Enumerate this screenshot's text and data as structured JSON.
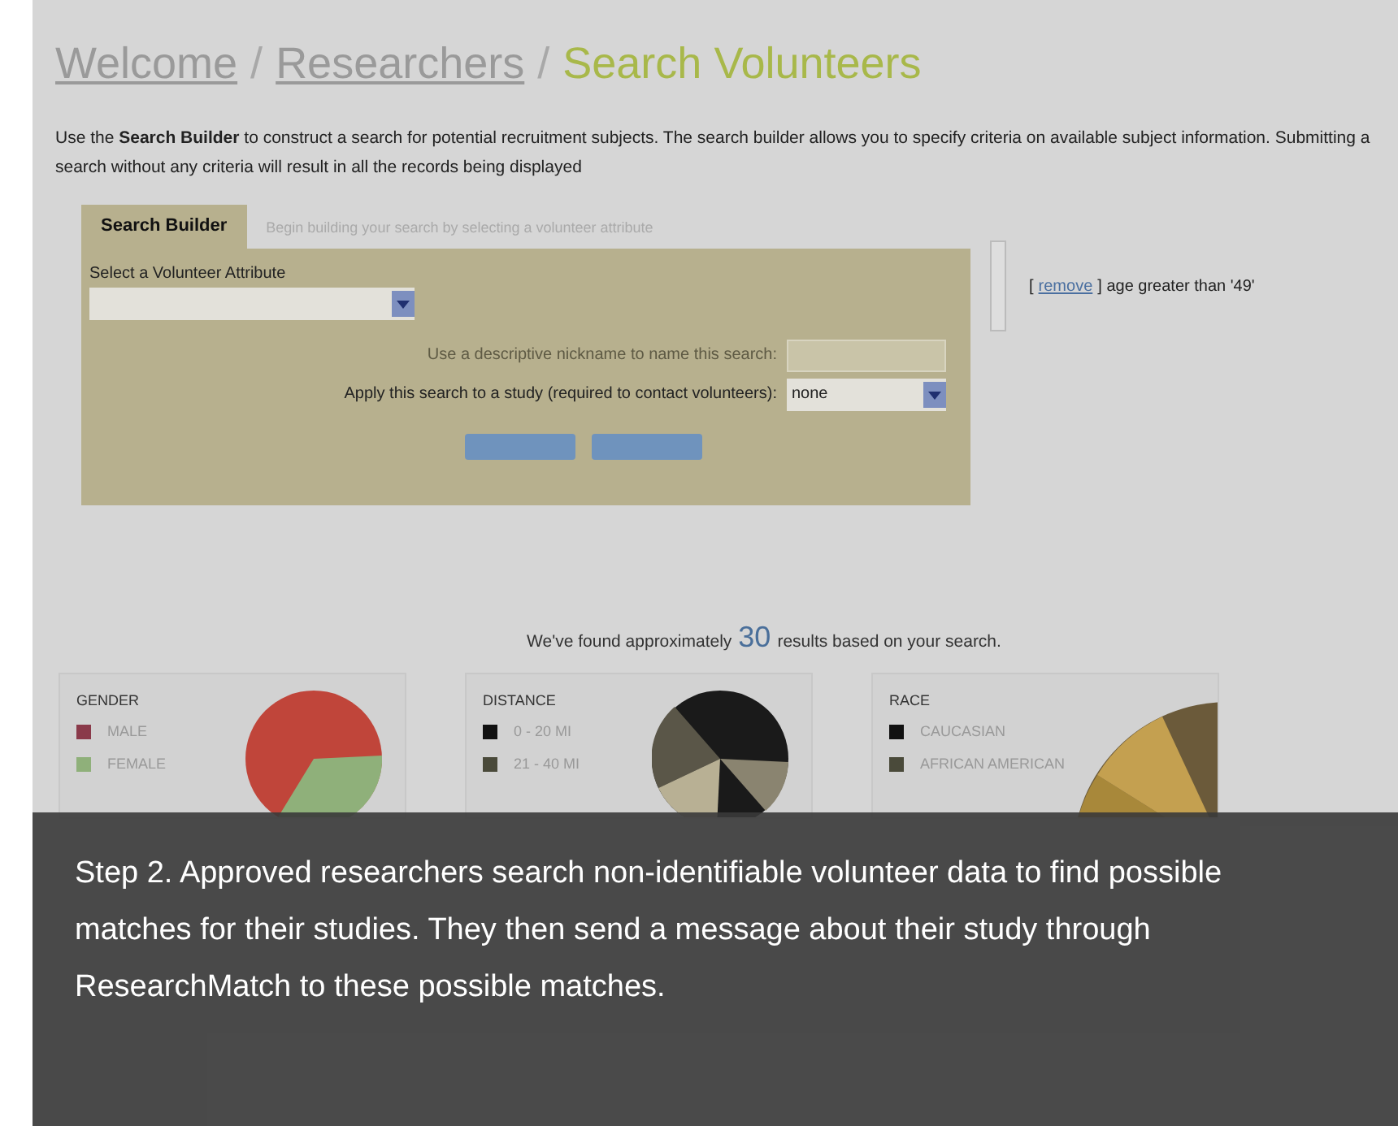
{
  "breadcrumb": [
    {
      "label": "Welcome",
      "kind": "link"
    },
    {
      "label": "/",
      "kind": "separator"
    },
    {
      "label": "Researchers",
      "kind": "link"
    },
    {
      "label": "/",
      "kind": "separator"
    },
    {
      "label": "Search Volunteers",
      "kind": "current"
    }
  ],
  "intro": "Use the **Search Builder** to construct a search for potential recruitment subjects. The search builder allows you to specify criteria on available subject information. Submitting a search without any criteria will result in all the records being displayed",
  "search_builder": {
    "tab": "Search Builder",
    "hint": "Begin building your search by selecting a volunteer attribute",
    "attribute_label": "Select a Volunteer Attribute",
    "nickname_label": "Use a descriptive nickname to name this search:",
    "study_label": "Apply this search to a study (required to contact volunteers):",
    "study_value": "none"
  },
  "criteria": {
    "prefix": "[",
    "link": "remove",
    "suffix": "] age greater than '49'"
  },
  "results": {
    "before": "We've found approximately",
    "count": "30",
    "after": "results based on your search."
  },
  "cards": [
    {
      "title": "GENDER",
      "legend": [
        {
          "label": "MALE",
          "color": "#8a3a4a"
        },
        {
          "label": "FEMALE",
          "color": "#8fb07a"
        }
      ]
    },
    {
      "title": "DISTANCE",
      "legend": [
        {
          "label": "0 - 20 MI",
          "color": "#111111"
        },
        {
          "label": "21 - 40 MI",
          "color": "#4a4a3a"
        }
      ]
    },
    {
      "title": "RACE",
      "legend": [
        {
          "label": "CAUCASIAN",
          "color": "#111111"
        },
        {
          "label": "AFRICAN AMERICAN",
          "color": "#4a4a3a"
        }
      ]
    }
  ],
  "caption": "Step 2.  Approved researchers search non-identifiable volunteer data to find possible matches for their studies.  They then send a message about their study through ResearchMatch to these possible matches."
}
